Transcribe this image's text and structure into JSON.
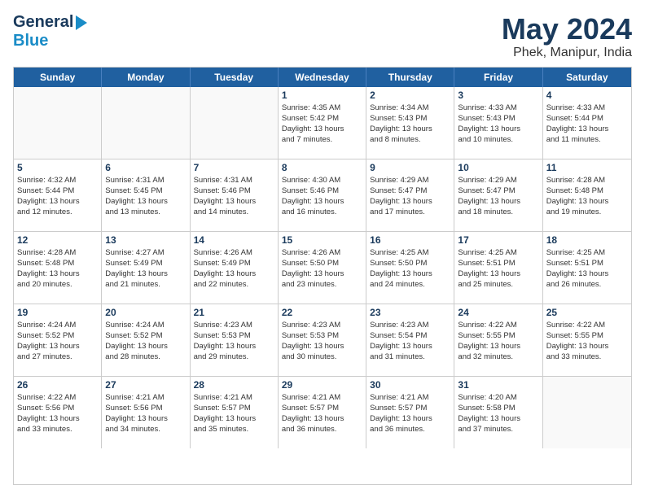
{
  "header": {
    "logo_general": "General",
    "logo_blue": "Blue",
    "title": "May 2024",
    "subtitle": "Phek, Manipur, India"
  },
  "calendar": {
    "days_of_week": [
      "Sunday",
      "Monday",
      "Tuesday",
      "Wednesday",
      "Thursday",
      "Friday",
      "Saturday"
    ],
    "weeks": [
      [
        {
          "day": "",
          "info": ""
        },
        {
          "day": "",
          "info": ""
        },
        {
          "day": "",
          "info": ""
        },
        {
          "day": "1",
          "info": "Sunrise: 4:35 AM\nSunset: 5:42 PM\nDaylight: 13 hours\nand 7 minutes."
        },
        {
          "day": "2",
          "info": "Sunrise: 4:34 AM\nSunset: 5:43 PM\nDaylight: 13 hours\nand 8 minutes."
        },
        {
          "day": "3",
          "info": "Sunrise: 4:33 AM\nSunset: 5:43 PM\nDaylight: 13 hours\nand 10 minutes."
        },
        {
          "day": "4",
          "info": "Sunrise: 4:33 AM\nSunset: 5:44 PM\nDaylight: 13 hours\nand 11 minutes."
        }
      ],
      [
        {
          "day": "5",
          "info": "Sunrise: 4:32 AM\nSunset: 5:44 PM\nDaylight: 13 hours\nand 12 minutes."
        },
        {
          "day": "6",
          "info": "Sunrise: 4:31 AM\nSunset: 5:45 PM\nDaylight: 13 hours\nand 13 minutes."
        },
        {
          "day": "7",
          "info": "Sunrise: 4:31 AM\nSunset: 5:46 PM\nDaylight: 13 hours\nand 14 minutes."
        },
        {
          "day": "8",
          "info": "Sunrise: 4:30 AM\nSunset: 5:46 PM\nDaylight: 13 hours\nand 16 minutes."
        },
        {
          "day": "9",
          "info": "Sunrise: 4:29 AM\nSunset: 5:47 PM\nDaylight: 13 hours\nand 17 minutes."
        },
        {
          "day": "10",
          "info": "Sunrise: 4:29 AM\nSunset: 5:47 PM\nDaylight: 13 hours\nand 18 minutes."
        },
        {
          "day": "11",
          "info": "Sunrise: 4:28 AM\nSunset: 5:48 PM\nDaylight: 13 hours\nand 19 minutes."
        }
      ],
      [
        {
          "day": "12",
          "info": "Sunrise: 4:28 AM\nSunset: 5:48 PM\nDaylight: 13 hours\nand 20 minutes."
        },
        {
          "day": "13",
          "info": "Sunrise: 4:27 AM\nSunset: 5:49 PM\nDaylight: 13 hours\nand 21 minutes."
        },
        {
          "day": "14",
          "info": "Sunrise: 4:26 AM\nSunset: 5:49 PM\nDaylight: 13 hours\nand 22 minutes."
        },
        {
          "day": "15",
          "info": "Sunrise: 4:26 AM\nSunset: 5:50 PM\nDaylight: 13 hours\nand 23 minutes."
        },
        {
          "day": "16",
          "info": "Sunrise: 4:25 AM\nSunset: 5:50 PM\nDaylight: 13 hours\nand 24 minutes."
        },
        {
          "day": "17",
          "info": "Sunrise: 4:25 AM\nSunset: 5:51 PM\nDaylight: 13 hours\nand 25 minutes."
        },
        {
          "day": "18",
          "info": "Sunrise: 4:25 AM\nSunset: 5:51 PM\nDaylight: 13 hours\nand 26 minutes."
        }
      ],
      [
        {
          "day": "19",
          "info": "Sunrise: 4:24 AM\nSunset: 5:52 PM\nDaylight: 13 hours\nand 27 minutes."
        },
        {
          "day": "20",
          "info": "Sunrise: 4:24 AM\nSunset: 5:52 PM\nDaylight: 13 hours\nand 28 minutes."
        },
        {
          "day": "21",
          "info": "Sunrise: 4:23 AM\nSunset: 5:53 PM\nDaylight: 13 hours\nand 29 minutes."
        },
        {
          "day": "22",
          "info": "Sunrise: 4:23 AM\nSunset: 5:53 PM\nDaylight: 13 hours\nand 30 minutes."
        },
        {
          "day": "23",
          "info": "Sunrise: 4:23 AM\nSunset: 5:54 PM\nDaylight: 13 hours\nand 31 minutes."
        },
        {
          "day": "24",
          "info": "Sunrise: 4:22 AM\nSunset: 5:55 PM\nDaylight: 13 hours\nand 32 minutes."
        },
        {
          "day": "25",
          "info": "Sunrise: 4:22 AM\nSunset: 5:55 PM\nDaylight: 13 hours\nand 33 minutes."
        }
      ],
      [
        {
          "day": "26",
          "info": "Sunrise: 4:22 AM\nSunset: 5:56 PM\nDaylight: 13 hours\nand 33 minutes."
        },
        {
          "day": "27",
          "info": "Sunrise: 4:21 AM\nSunset: 5:56 PM\nDaylight: 13 hours\nand 34 minutes."
        },
        {
          "day": "28",
          "info": "Sunrise: 4:21 AM\nSunset: 5:57 PM\nDaylight: 13 hours\nand 35 minutes."
        },
        {
          "day": "29",
          "info": "Sunrise: 4:21 AM\nSunset: 5:57 PM\nDaylight: 13 hours\nand 36 minutes."
        },
        {
          "day": "30",
          "info": "Sunrise: 4:21 AM\nSunset: 5:57 PM\nDaylight: 13 hours\nand 36 minutes."
        },
        {
          "day": "31",
          "info": "Sunrise: 4:20 AM\nSunset: 5:58 PM\nDaylight: 13 hours\nand 37 minutes."
        },
        {
          "day": "",
          "info": ""
        }
      ]
    ]
  }
}
